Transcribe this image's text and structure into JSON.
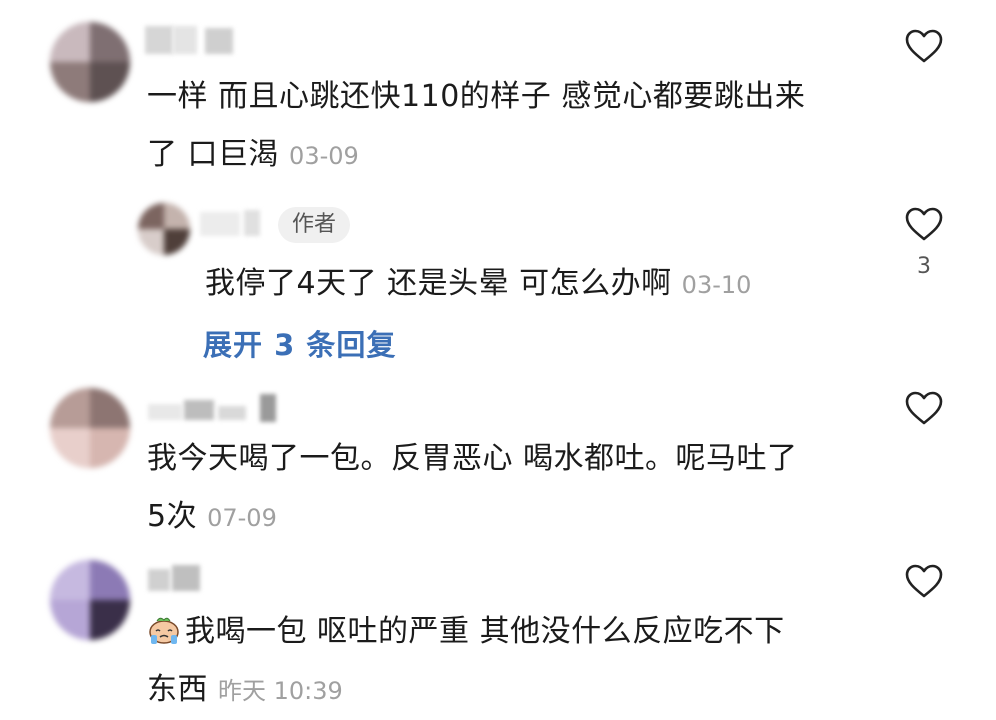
{
  "comments": [
    {
      "text_line1": "一样 而且心跳还快110的样子 感觉心都要跳出来",
      "text_line2": "了 口巨渴",
      "date": "03-09",
      "like_count": "",
      "reply": {
        "author_badge": "作者",
        "text": "我停了4天了 还是头晕 可怎么办啊",
        "date": "03-10",
        "like_count": "3"
      },
      "expand_label": "展开 3 条回复"
    },
    {
      "text_line1": "我今天喝了一包。反胃恶心 喝水都吐。呢马吐了",
      "text_line2": "5次",
      "date": "07-09",
      "like_count": ""
    },
    {
      "text_line1": "我喝一包 呕吐的严重 其他没什么反应吃不下",
      "text_line2": "东西",
      "date": "昨天 10:39",
      "like_count": "",
      "emoji": "crying-face-emoji"
    }
  ],
  "colors": {
    "link": "#3b6fb6",
    "meta": "#a0a0a0",
    "badge_bg": "#f0f0f0"
  }
}
